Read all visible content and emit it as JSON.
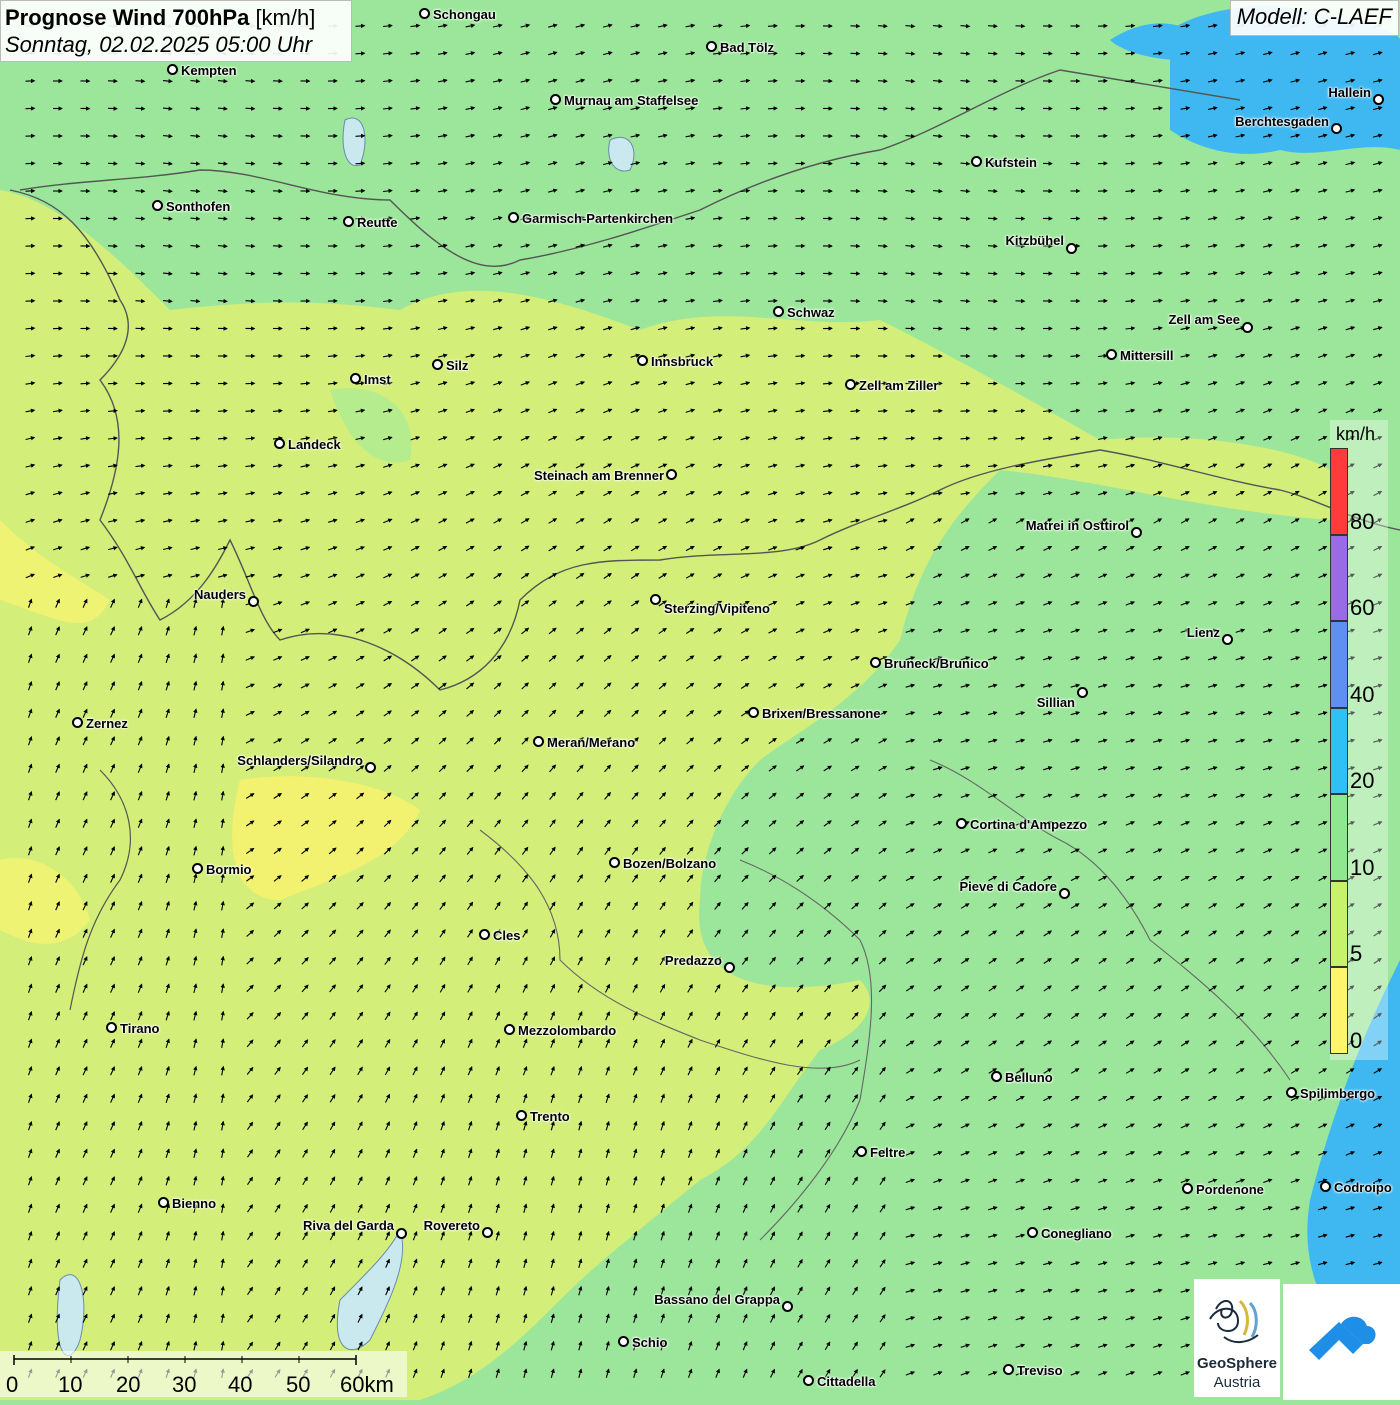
{
  "header": {
    "title_bold": "Prognose Wind 700hPa",
    "title_unit": "[km/h]",
    "datetime": "Sonntag, 02.02.2025 05:00 Uhr",
    "model": "Modell: C-LAEF"
  },
  "cities": [
    {
      "name": "Schongau"
    },
    {
      "name": "Bad Tölz"
    },
    {
      "name": "Kempten"
    },
    {
      "name": "Murnau am Staffelsee"
    },
    {
      "name": "Hallein"
    },
    {
      "name": "Berchtesgaden"
    },
    {
      "name": "Kufstein"
    },
    {
      "name": "Sonthofen"
    },
    {
      "name": "Reutte"
    },
    {
      "name": "Garmisch-Partenkirchen"
    },
    {
      "name": "Kitzbühel"
    },
    {
      "name": "Schwaz"
    },
    {
      "name": "Zell am See"
    },
    {
      "name": "Mittersill"
    },
    {
      "name": "Innsbruck"
    },
    {
      "name": "Silz"
    },
    {
      "name": "Imst"
    },
    {
      "name": "Zell am Ziller"
    },
    {
      "name": "Landeck"
    },
    {
      "name": "Steinach am Brenner"
    },
    {
      "name": "Matrei in Osttirol"
    },
    {
      "name": "Nauders"
    },
    {
      "name": "Sterzing/Vipiteno"
    },
    {
      "name": "Lienz"
    },
    {
      "name": "Bruneck/Brunico"
    },
    {
      "name": "Sillian"
    },
    {
      "name": "Brixen/Bressanone"
    },
    {
      "name": "Zernez"
    },
    {
      "name": "Meran/Merano"
    },
    {
      "name": "Schlanders/Silandro"
    },
    {
      "name": "Cortina d'Ampezzo"
    },
    {
      "name": "Bozen/Bolzano"
    },
    {
      "name": "Bormio"
    },
    {
      "name": "Pieve di Cadore"
    },
    {
      "name": "Cles"
    },
    {
      "name": "Predazzo"
    },
    {
      "name": "Tirano"
    },
    {
      "name": "Mezzolombardo"
    },
    {
      "name": "Belluno"
    },
    {
      "name": "Spilimbergo"
    },
    {
      "name": "Trento"
    },
    {
      "name": "Feltre"
    },
    {
      "name": "Pordenone"
    },
    {
      "name": "Codroipo"
    },
    {
      "name": "Bienno"
    },
    {
      "name": "Riva del Garda"
    },
    {
      "name": "Rovereto"
    },
    {
      "name": "Conegliano"
    },
    {
      "name": "Bassano del Grappa"
    },
    {
      "name": "Schio"
    },
    {
      "name": "Treviso"
    },
    {
      "name": "Cittadella"
    }
  ],
  "legend": {
    "unit": "km/h",
    "ticks": [
      "80",
      "60",
      "40",
      "20",
      "10",
      "5",
      "0"
    ],
    "colors": [
      "#ff3b3b",
      "#9a6be6",
      "#5f8ff0",
      "#2fc1f5",
      "#8ee88f",
      "#c8f26a",
      "#fff56a"
    ]
  },
  "scale_bar": {
    "labels": [
      "0",
      "10",
      "20",
      "30",
      "40",
      "50",
      "60km"
    ]
  },
  "logo": {
    "line1": "GeoSphere",
    "line2": "Austria"
  },
  "colors": {
    "calm_yellow": "#f4f36e",
    "light_green_yellow": "#d9f27a",
    "green": "#9be69a",
    "blue": "#3fb8f2"
  }
}
